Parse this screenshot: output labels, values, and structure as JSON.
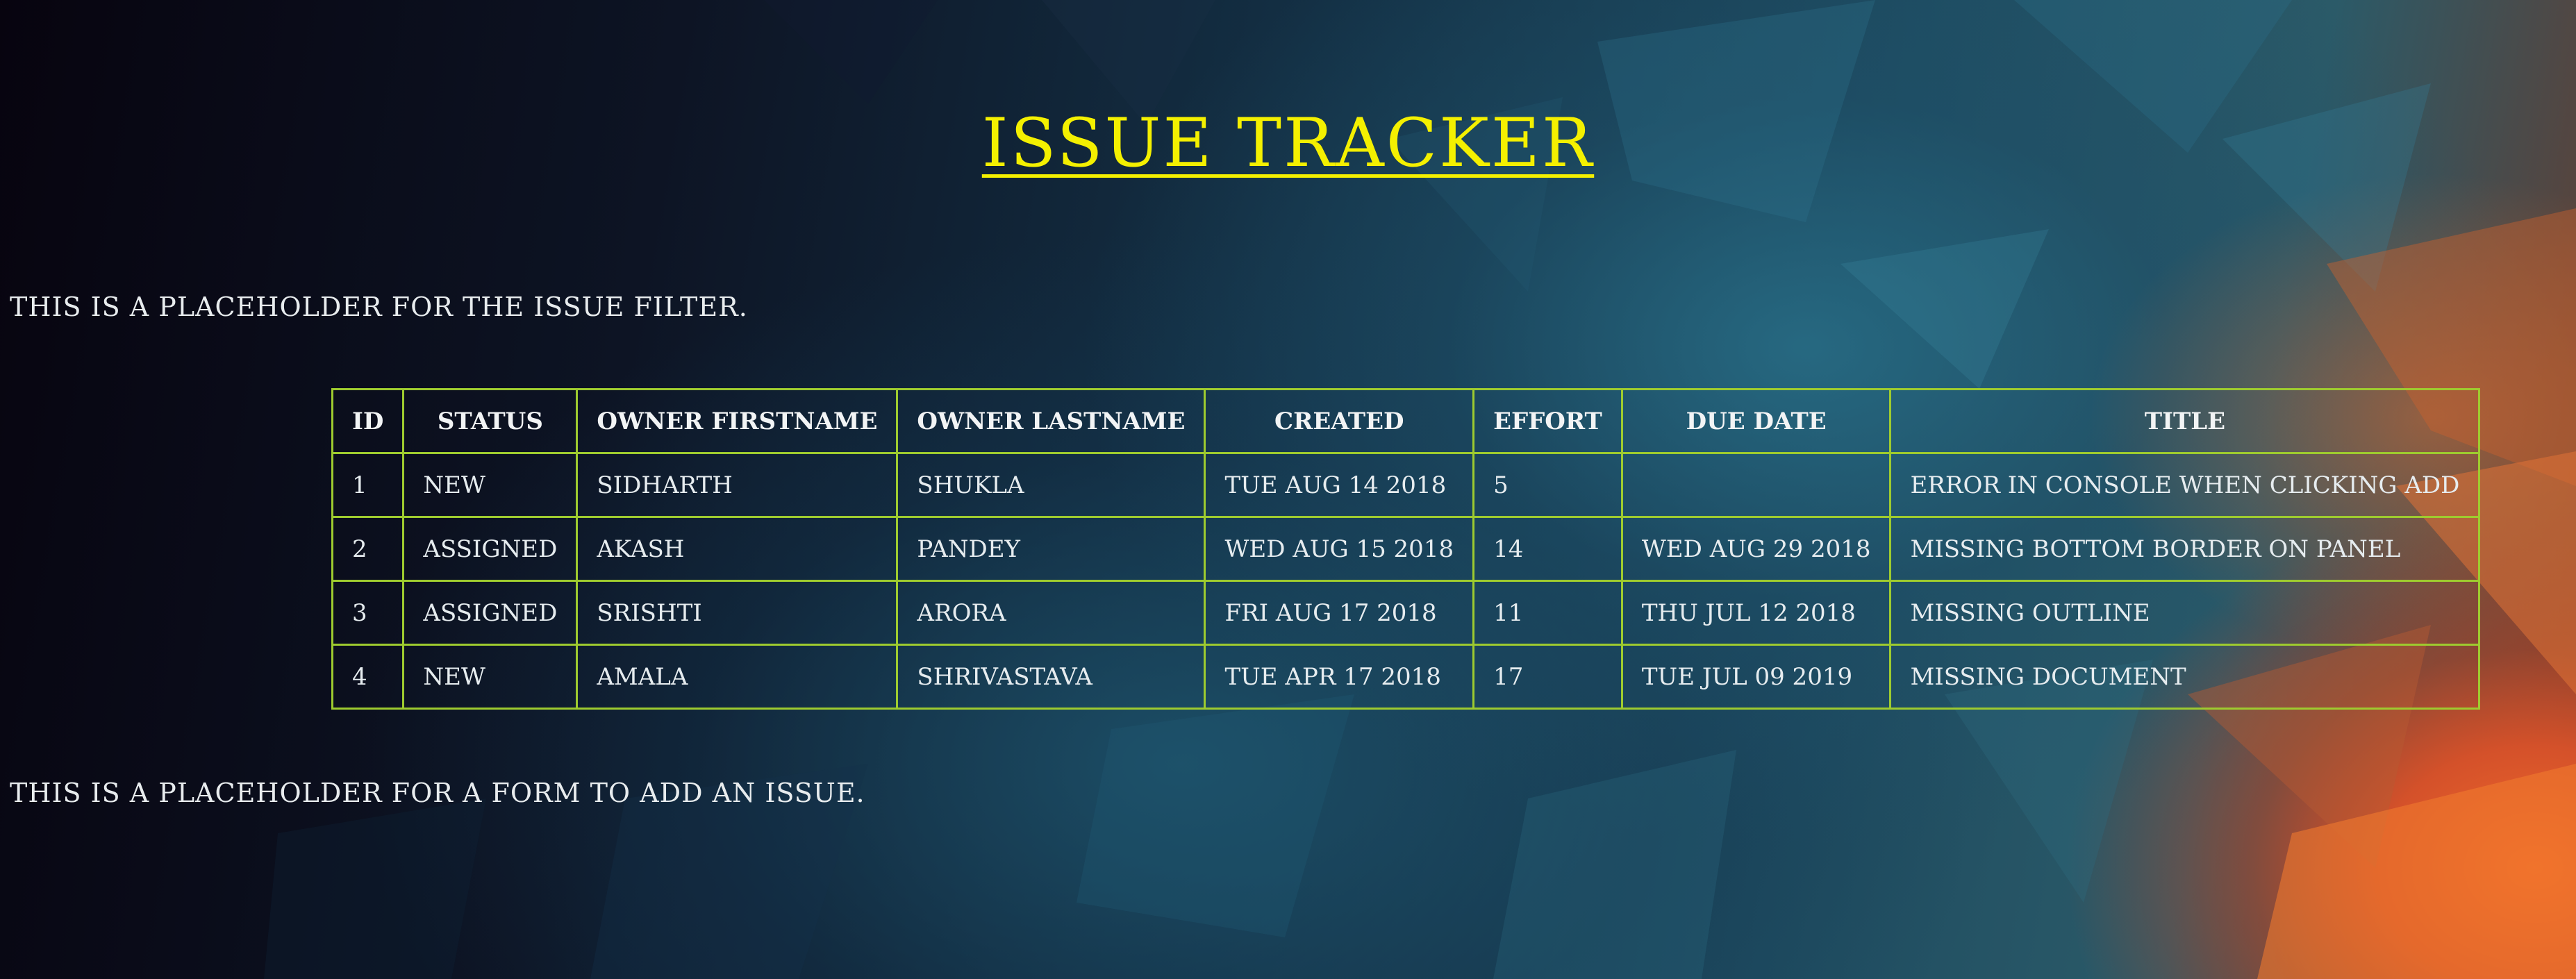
{
  "app": {
    "title": "ISSUE TRACKER"
  },
  "filter_placeholder": "THIS IS A PLACEHOLDER FOR THE ISSUE FILTER.",
  "add_placeholder": "THIS IS A PLACEHOLDER FOR A FORM TO ADD AN ISSUE.",
  "table": {
    "headers": [
      "ID",
      "STATUS",
      "OWNER FIRSTNAME",
      "OWNER LASTNAME",
      "CREATED",
      "EFFORT",
      "DUE DATE",
      "TITLE"
    ],
    "rows": [
      [
        "1",
        "NEW",
        "SIDHARTH",
        "SHUKLA",
        "TUE AUG 14 2018",
        "5",
        "",
        "ERROR IN CONSOLE WHEN CLICKING ADD"
      ],
      [
        "2",
        "ASSIGNED",
        "AKASH",
        "PANDEY",
        "WED AUG 15 2018",
        "14",
        "WED AUG 29 2018",
        "MISSING BOTTOM BORDER ON PANEL"
      ],
      [
        "3",
        "ASSIGNED",
        "SRISHTI",
        "ARORA",
        "FRI AUG 17 2018",
        "11",
        "THU JUL 12 2018",
        "MISSING OUTLINE"
      ],
      [
        "4",
        "NEW",
        "AMALA",
        "SHRIVASTAVA",
        "TUE APR 17 2018",
        "17",
        "TUE JUL 09 2019",
        "MISSING DOCUMENT"
      ]
    ]
  },
  "colors": {
    "title": "#f4f000",
    "table_border": "#9ecb2f",
    "background_dark": "#07040f",
    "background_teal": "#1e4c61",
    "accent_orange": "#f26a2a"
  }
}
